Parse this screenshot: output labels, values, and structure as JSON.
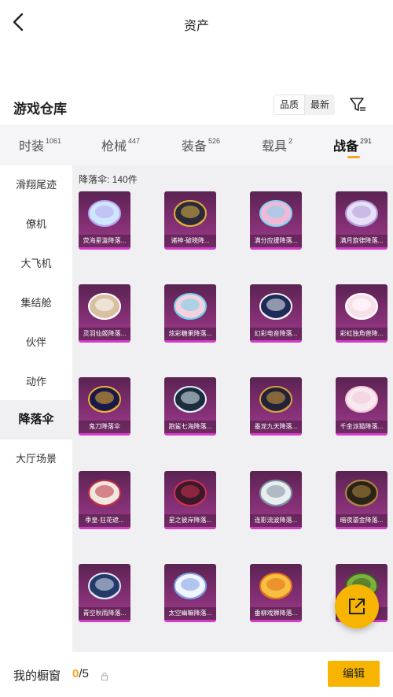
{
  "header": {
    "title": "资产"
  },
  "section": {
    "title": "游戏仓库",
    "sort_options": [
      "品质",
      "最新"
    ]
  },
  "tabs": [
    {
      "label": "时装",
      "count": "1061"
    },
    {
      "label": "枪械",
      "count": "447"
    },
    {
      "label": "装备",
      "count": "526"
    },
    {
      "label": "载具",
      "count": "2"
    },
    {
      "label": "战备",
      "count": "291"
    }
  ],
  "sidebar": {
    "items": [
      "滑翔尾迹",
      "僚机",
      "大飞机",
      "集结舱",
      "伙伴",
      "动作",
      "降落伞",
      "大厅场景"
    ]
  },
  "content": {
    "count_label": "降落伞: 140件",
    "items": [
      {
        "name": "荧海星漩降落..."
      },
      {
        "name": "诸神·破晓降..."
      },
      {
        "name": "满分应援降落..."
      },
      {
        "name": "满月旋律降落..."
      },
      {
        "name": "灵羽仙姬降落..."
      },
      {
        "name": "炫彩糖果降落..."
      },
      {
        "name": "幻彩电音降落..."
      },
      {
        "name": "彩虹独角兽降..."
      },
      {
        "name": "鬼刀降落伞"
      },
      {
        "name": "跑鲨七海降落..."
      },
      {
        "name": "墨龙九天降落..."
      },
      {
        "name": "千金派猫降落..."
      },
      {
        "name": "季皇·狂花遮..."
      },
      {
        "name": "星之彼岸降落..."
      },
      {
        "name": "连影流波降落..."
      },
      {
        "name": "暗夜鎏金降落..."
      },
      {
        "name": "青空秋雨降落..."
      },
      {
        "name": "太空幽嘛降落..."
      },
      {
        "name": "垂柳戏狮降落..."
      },
      {
        "name": ""
      }
    ]
  },
  "bottom": {
    "label": "我的橱窗",
    "current": "0",
    "total": "/5",
    "edit_label": "编辑"
  },
  "colors": {
    "accent": "#f7b400",
    "card_border": "#d23cc7",
    "card_bg": "#7a2c6c"
  }
}
